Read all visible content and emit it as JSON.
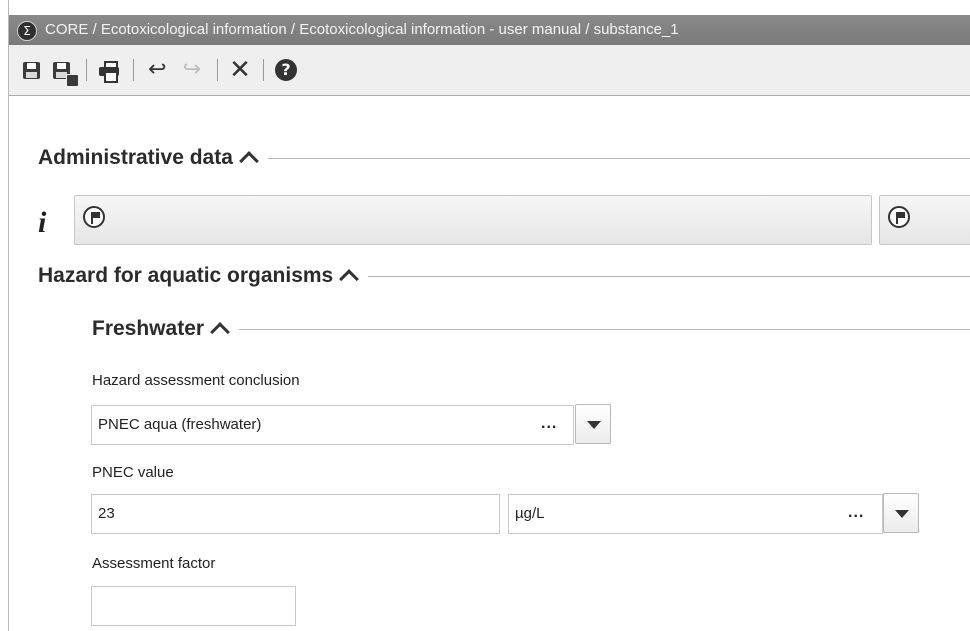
{
  "window": {
    "app_icon": "sigma-icon",
    "title": "CORE / Ecotoxicological information / Ecotoxicological information - user manual / substance_1"
  },
  "toolbar": {
    "buttons": [
      "save-icon",
      "save-as-icon",
      "print-icon",
      "undo-icon",
      "redo-icon",
      "close-icon",
      "help-icon"
    ],
    "help_glyph": "?",
    "close_glyph": "✕"
  },
  "sections": {
    "administrative": {
      "title": "Administrative data"
    },
    "hazard": {
      "title": "Hazard for aquatic organisms"
    },
    "freshwater": {
      "title": "Freshwater"
    }
  },
  "admin": {
    "info_glyph": "i"
  },
  "fields": {
    "conclusion": {
      "label": "Hazard assessment conclusion",
      "value": "PNEC aqua (freshwater)",
      "ellipsis": "..."
    },
    "pnec": {
      "label": "PNEC value",
      "value": "23",
      "unit": "µg/L",
      "ellipsis": "..."
    },
    "assessment_factor": {
      "label": "Assessment factor",
      "value": ""
    }
  },
  "colors": {
    "titlebar": "#808080",
    "toolbar": "#efefef",
    "accent_text": "#2b2b2b"
  }
}
